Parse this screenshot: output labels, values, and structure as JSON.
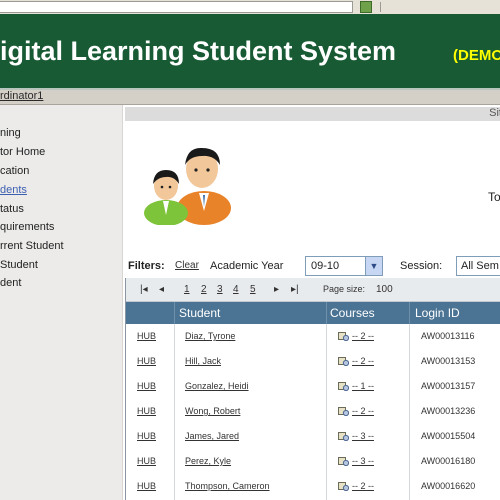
{
  "header": {
    "title": "igital Learning Student System",
    "tag": "(DEMO"
  },
  "userbar": {
    "user": "rdinator1"
  },
  "sidebar": {
    "items": [
      {
        "label": "ning"
      },
      {
        "label": "tor Home"
      },
      {
        "label": "cation"
      },
      {
        "label": "dents",
        "active": true
      },
      {
        "label": "tatus"
      },
      {
        "label": "quirements"
      },
      {
        "label": "rrent Student"
      },
      {
        "label": " Student"
      },
      {
        "label": "dent"
      }
    ]
  },
  "main": {
    "strip_text": "Sit",
    "to_text": "To"
  },
  "filters": {
    "label": "Filters:",
    "clear": "Clear",
    "academic_year_label": "Academic Year",
    "academic_year_value": "09-10",
    "session_label": "Session:",
    "session_value": "All Sem"
  },
  "pager": {
    "first": "|◂",
    "prev": "◂",
    "pages": [
      "1",
      "2",
      "3",
      "4",
      "5"
    ],
    "next": "▸",
    "last": "▸|",
    "page_size_label": "Page size:",
    "page_size_value": "100"
  },
  "table": {
    "columns": [
      "Student",
      "Courses",
      "Login ID"
    ],
    "rows": [
      {
        "hub": "HUB",
        "name": "Diaz, Tyrone",
        "courses": "-- 2 --",
        "login": "AW00013116"
      },
      {
        "hub": "HUB",
        "name": "Hill, Jack",
        "courses": "-- 2 --",
        "login": "AW00013153"
      },
      {
        "hub": "HUB",
        "name": "Gonzalez, Heidi",
        "courses": "-- 1 --",
        "login": "AW00013157"
      },
      {
        "hub": "HUB",
        "name": "Wong, Robert",
        "courses": "-- 2 --",
        "login": "AW00013236"
      },
      {
        "hub": "HUB",
        "name": "James, Jared",
        "courses": "-- 3 --",
        "login": "AW00015504"
      },
      {
        "hub": "HUB",
        "name": "Perez, Kyle",
        "courses": "-- 3 --",
        "login": "AW00016180"
      },
      {
        "hub": "HUB",
        "name": "Thompson, Cameron",
        "courses": "-- 2 --",
        "login": "AW00016620"
      }
    ]
  },
  "colors": {
    "header_green": "#175a33",
    "demo_yellow": "#ffff00",
    "grid_header": "#4a7394",
    "link_blue": "#3d5fb0"
  },
  "icons": [
    "book-icon",
    "person-green-icon",
    "person-orange-icon",
    "dropdown-arrow-icon"
  ]
}
